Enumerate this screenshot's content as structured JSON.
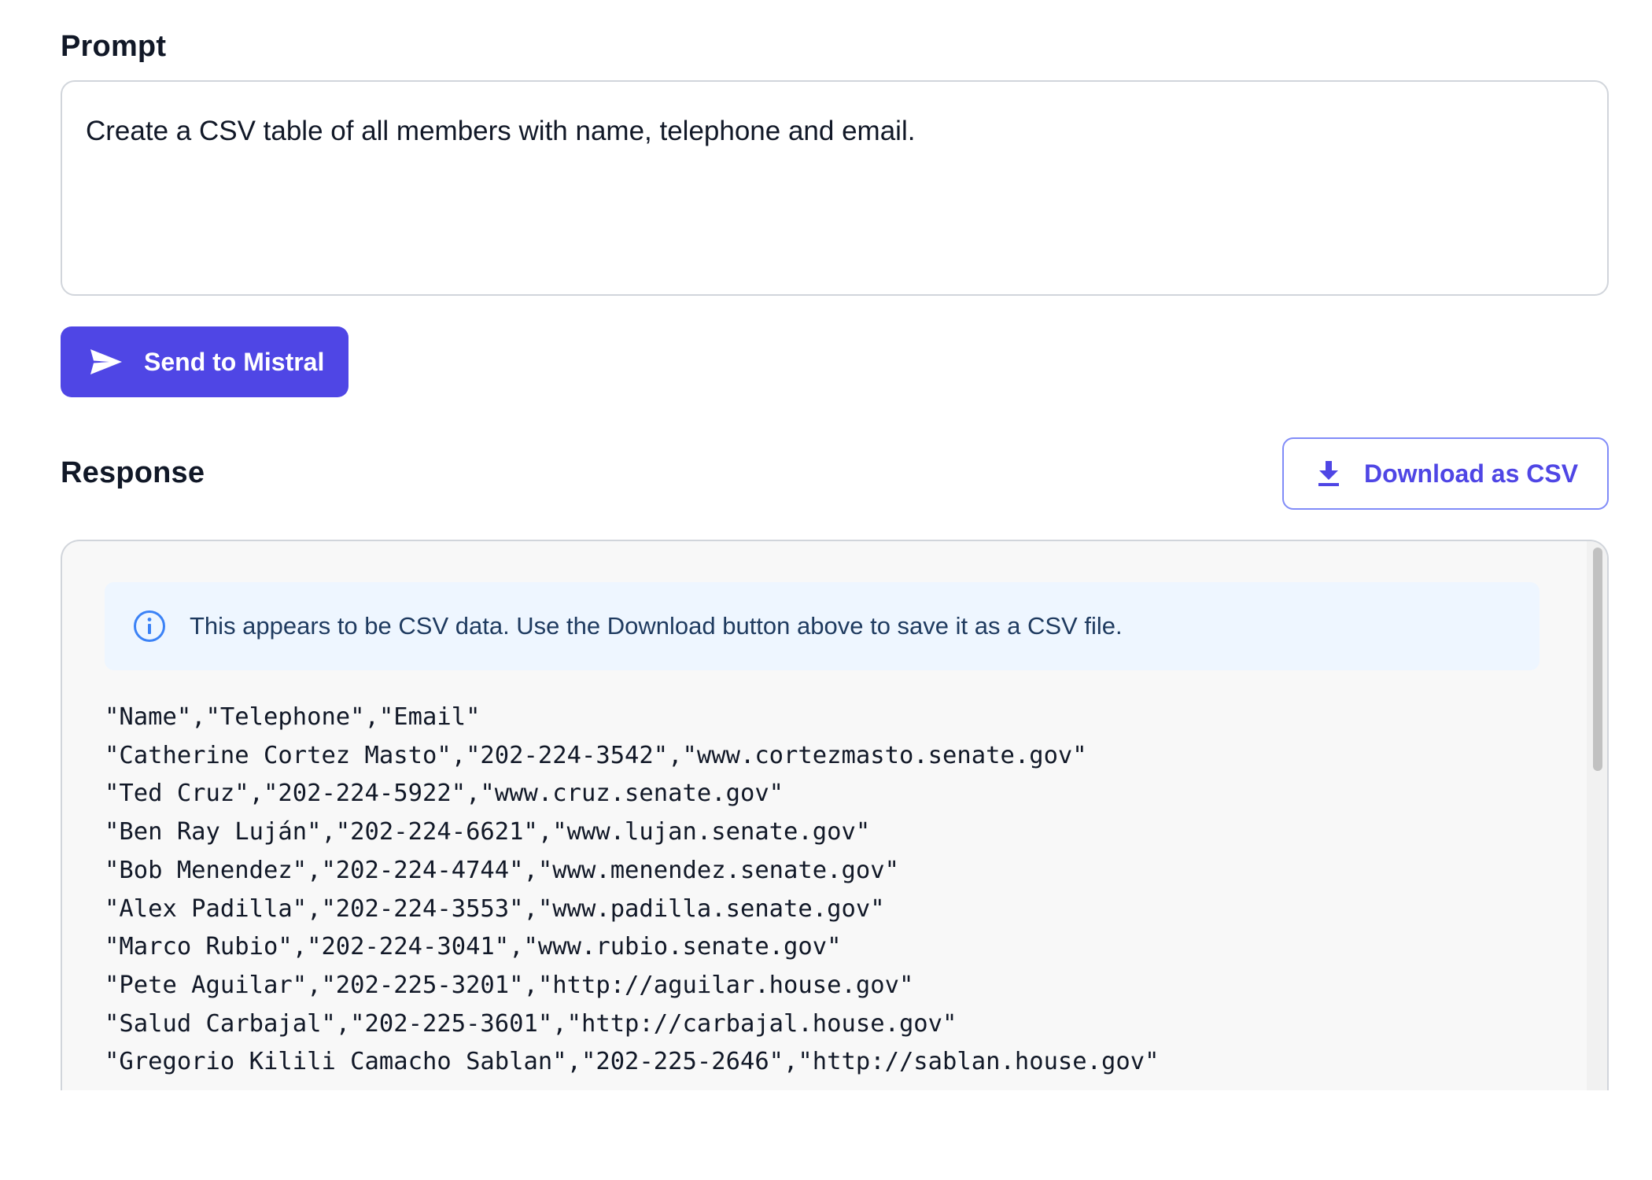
{
  "prompt": {
    "label": "Prompt",
    "value": "Create a CSV table of all members with name, telephone and email.",
    "send_button_label": "Send to Mistral",
    "send_icon": "send-icon"
  },
  "response": {
    "label": "Response",
    "download_button_label": "Download as CSV",
    "download_icon": "download-icon",
    "info_icon": "info-icon",
    "info_text": "This appears to be CSV data. Use the Download button above to save it as a CSV file.",
    "csv_lines": [
      "\"Name\",\"Telephone\",\"Email\"",
      "\"Catherine Cortez Masto\",\"202-224-3542\",\"www.cortezmasto.senate.gov\"",
      "\"Ted Cruz\",\"202-224-5922\",\"www.cruz.senate.gov\"",
      "\"Ben Ray Luján\",\"202-224-6621\",\"www.lujan.senate.gov\"",
      "\"Bob Menendez\",\"202-224-4744\",\"www.menendez.senate.gov\"",
      "\"Alex Padilla\",\"202-224-3553\",\"www.padilla.senate.gov\"",
      "\"Marco Rubio\",\"202-224-3041\",\"www.rubio.senate.gov\"",
      "\"Pete Aguilar\",\"202-225-3201\",\"http://aguilar.house.gov\"",
      "\"Salud Carbajal\",\"202-225-3601\",\"http://carbajal.house.gov\"",
      "\"Gregorio Kilili Camacho Sablan\",\"202-225-2646\",\"http://sablan.house.gov\""
    ]
  },
  "colors": {
    "accent": "#4f46e5",
    "info_bg": "#eef6ff",
    "info_icon": "#3b82f6"
  }
}
